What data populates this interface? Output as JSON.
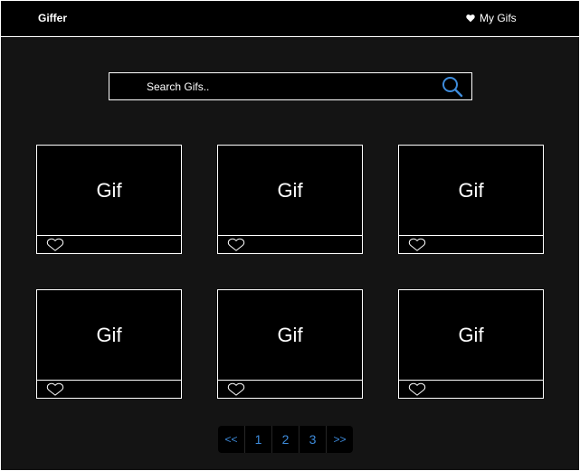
{
  "app": {
    "brand": "Giffer",
    "my_gifs_label": "My Gifs"
  },
  "search": {
    "placeholder": "Search Gifs..",
    "value": "",
    "icon": "search-icon"
  },
  "cards": [
    {
      "label": "Gif"
    },
    {
      "label": "Gif"
    },
    {
      "label": "Gif"
    },
    {
      "label": "Gif"
    },
    {
      "label": "Gif"
    },
    {
      "label": "Gif"
    }
  ],
  "pagination": {
    "prev": "<<",
    "pages": [
      "1",
      "2",
      "3"
    ],
    "next": ">>"
  },
  "colors": {
    "background": "#141414",
    "surface": "#000000",
    "border": "#ffffff",
    "accent": "#3d8bdb"
  }
}
